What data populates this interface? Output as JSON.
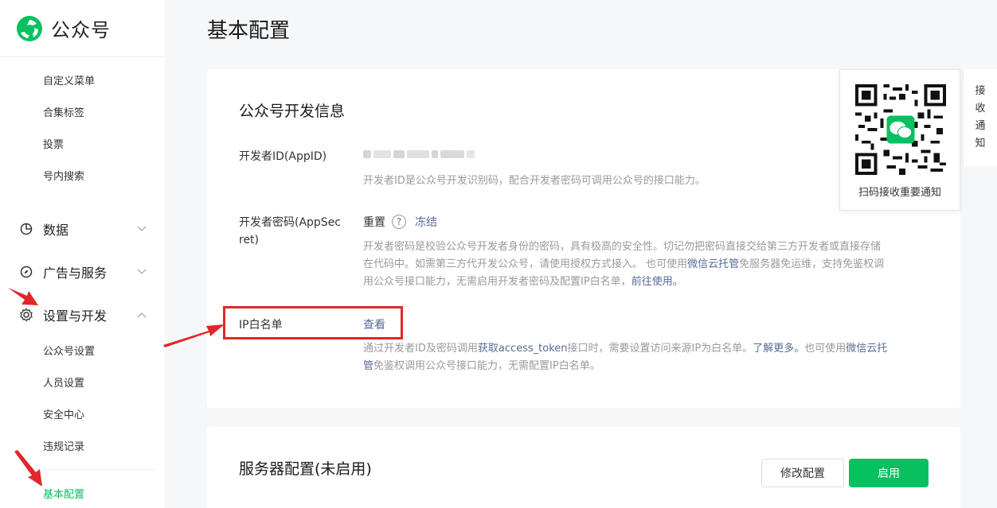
{
  "brand": {
    "name": "公众号"
  },
  "sidebar": {
    "top_items": [
      "自定义菜单",
      "合集标签",
      "投票",
      "号内搜索"
    ],
    "groups": [
      {
        "label": "数据",
        "icon": "pie-chart-icon",
        "chevron": "down"
      },
      {
        "label": "广告与服务",
        "icon": "compass-icon",
        "chevron": "down"
      },
      {
        "label": "设置与开发",
        "icon": "gear-icon",
        "chevron": "up"
      }
    ],
    "settings_items": [
      "公众号设置",
      "人员设置",
      "安全中心",
      "违规记录"
    ],
    "active_item": "基本配置"
  },
  "page": {
    "title": "基本配置"
  },
  "dev_info": {
    "title": "公众号开发信息",
    "appid": {
      "label": "开发者ID(AppID)",
      "desc": "开发者ID是公众号开发识别码，配合开发者密码可调用公众号的接口能力。"
    },
    "secret": {
      "label_line1": "开发者密码(AppSec",
      "label_line2": "ret)",
      "reset": "重置",
      "help": "?",
      "freeze": "冻结",
      "desc_line1": "开发者密码是校验公众号开发者身份的密码，具有极高的安全性。切记勿把密码直接交给第三方开发者或直接存储",
      "desc_line2_a": "在代码中。如需第三方代开发公众号，请使用授权方式接入。 也可使用",
      "desc_line2_link": "微信云托管",
      "desc_line2_b": "免服务器免运维，支持免鉴权调",
      "desc_line3_a": "用公众号接口能力，无需启用开发者密码及配置IP白名单，",
      "desc_line3_link": "前往使用。"
    },
    "ip_whitelist": {
      "label": "IP白名单",
      "view": "查看",
      "desc_line1_a": "通过开发者ID及密码调用",
      "desc_line1_link1": "获取access_token",
      "desc_line1_b": "接口时，需要设置访问来源IP为白名单。",
      "desc_line1_link2": "了解更多。",
      "desc_line1_c": "也可使用",
      "desc_line1_link3": "微信云托",
      "desc_line2_link": "管",
      "desc_line2_b": "免鉴权调用公众号接口能力，无需配置IP白名单。"
    }
  },
  "qr_panel": {
    "caption": "扫码接收重要通知",
    "side_tab": [
      "接",
      "收",
      "通",
      "知"
    ]
  },
  "server_config": {
    "title": "服务器配置(未启用)",
    "modify_button": "修改配置",
    "enable_button": "启用"
  },
  "colors": {
    "accent": "#07c160",
    "link": "#576b95",
    "annotation_red": "#e0272a"
  }
}
